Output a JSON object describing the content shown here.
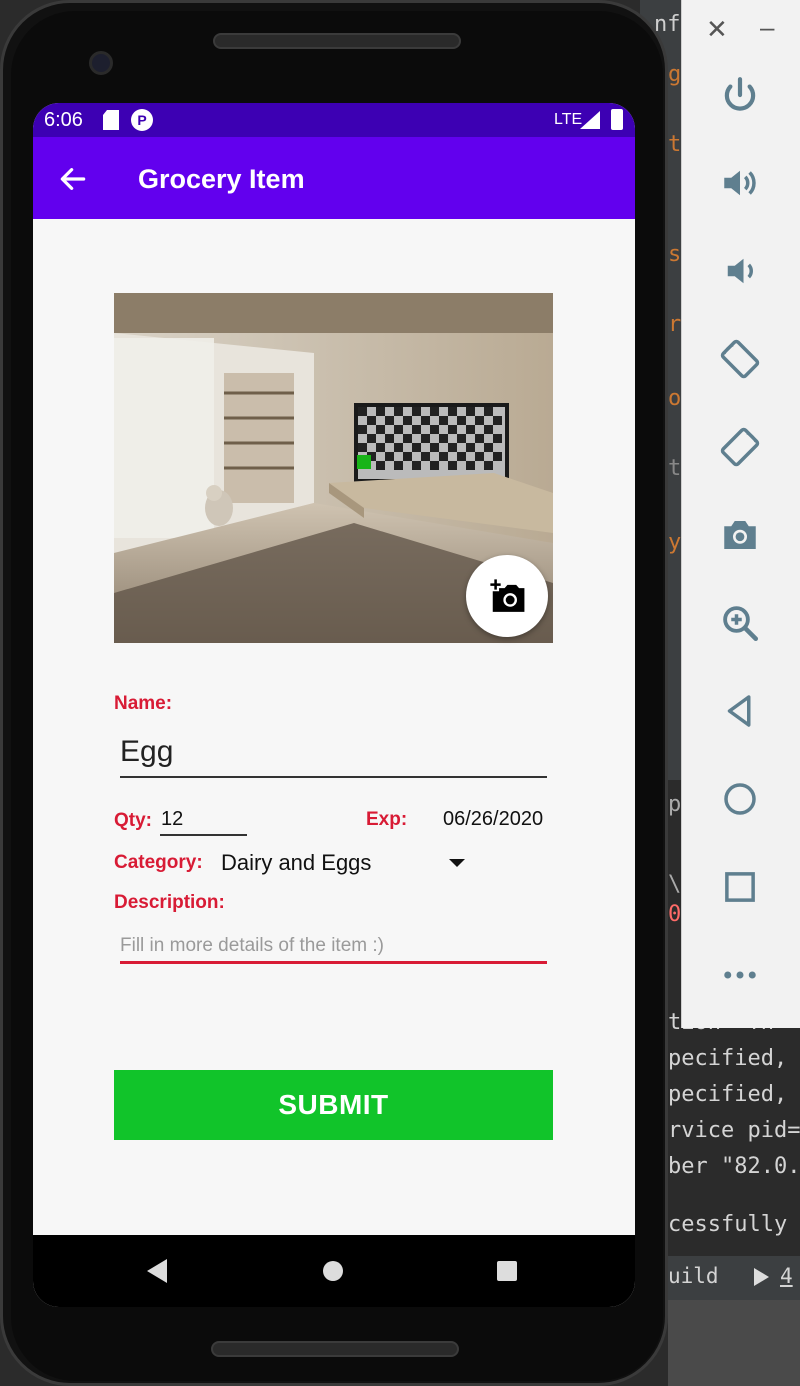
{
  "ide": {
    "lines": [
      "nf",
      "g",
      "t",
      "s",
      "r",
      "o",
      "t",
      "y",
      "p",
      "\\",
      "0",
      "tion  Th",
      "pecified,",
      "pecified,",
      "rvice pid=",
      "ber \"82.0.",
      "cessfully f"
    ],
    "tab_label": "uild",
    "run_label": "4"
  },
  "emulator_toolbar": {
    "buttons": [
      "power-icon",
      "volume-up-icon",
      "volume-down-icon",
      "rotate-left-icon",
      "rotate-right-icon",
      "screenshot-camera-icon",
      "zoom-icon",
      "back-icon",
      "home-icon",
      "overview-icon",
      "more-icon"
    ]
  },
  "status_bar": {
    "time": "6:06",
    "network": "LTE"
  },
  "app_bar": {
    "title": "Grocery Item"
  },
  "form": {
    "name_label": "Name:",
    "name_value": "Egg",
    "qty_label": "Qty:",
    "qty_value": "12",
    "exp_label": "Exp:",
    "exp_value": "06/26/2020",
    "category_label": "Category:",
    "category_value": "Dairy and Eggs",
    "description_label": "Description:",
    "description_placeholder": "Fill in more details of the item :)",
    "submit_label": "SUBMIT"
  },
  "colors": {
    "status_bar": "#3d00b3",
    "app_bar": "#6200ee",
    "label_red": "#d81b35",
    "submit_green": "#11c42a"
  }
}
